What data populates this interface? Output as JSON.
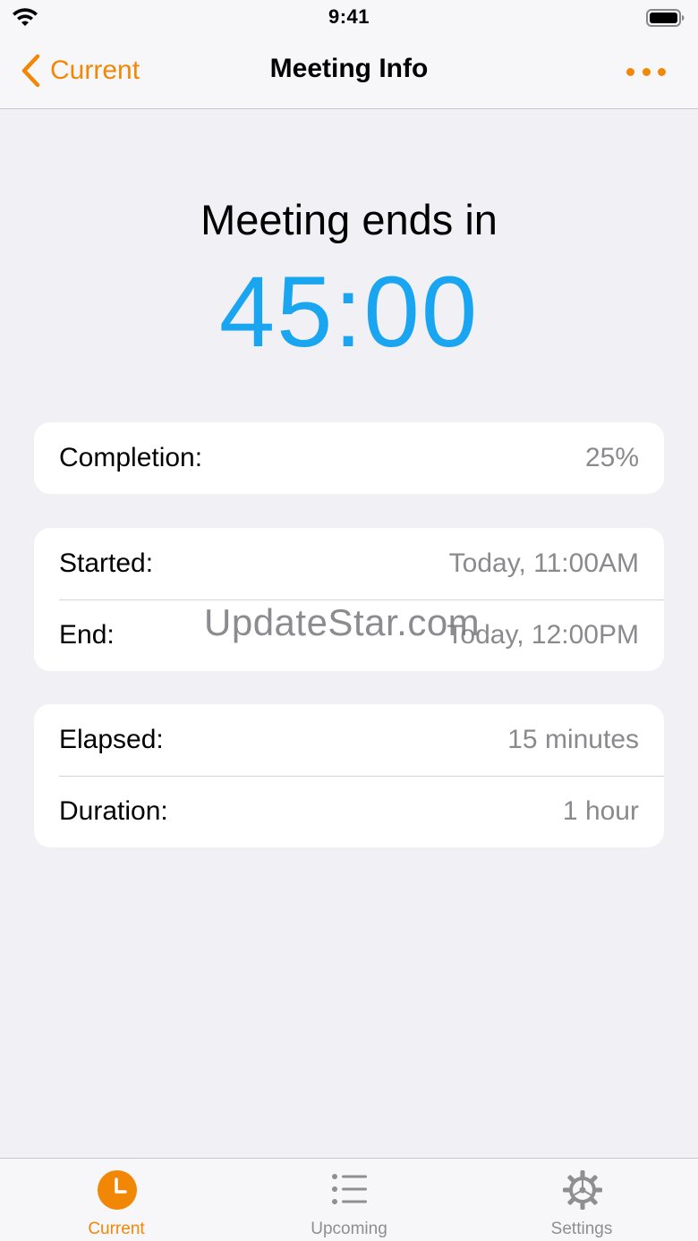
{
  "status_bar": {
    "time": "9:41"
  },
  "nav": {
    "back_label": "Current",
    "title": "Meeting Info"
  },
  "hero": {
    "label": "Meeting ends in",
    "countdown": "45:00"
  },
  "cards": {
    "completion": {
      "label": "Completion:",
      "value": "25%"
    },
    "times": [
      {
        "label": "Started:",
        "value": "Today, 11:00AM"
      },
      {
        "label": "End:",
        "value": "Today, 12:00PM"
      }
    ],
    "durations": [
      {
        "label": "Elapsed:",
        "value": "15 minutes"
      },
      {
        "label": "Duration:",
        "value": "1 hour"
      }
    ]
  },
  "watermark": "UpdateStar.com",
  "tabs": [
    {
      "label": "Current",
      "icon": "clock-icon",
      "active": true
    },
    {
      "label": "Upcoming",
      "icon": "list-icon",
      "active": false
    },
    {
      "label": "Settings",
      "icon": "gear-icon",
      "active": false
    }
  ],
  "colors": {
    "accent": "#f28705",
    "countdown": "#1aa5f0",
    "background": "#f0f0f5",
    "secondary_text": "#8a8a8e"
  }
}
